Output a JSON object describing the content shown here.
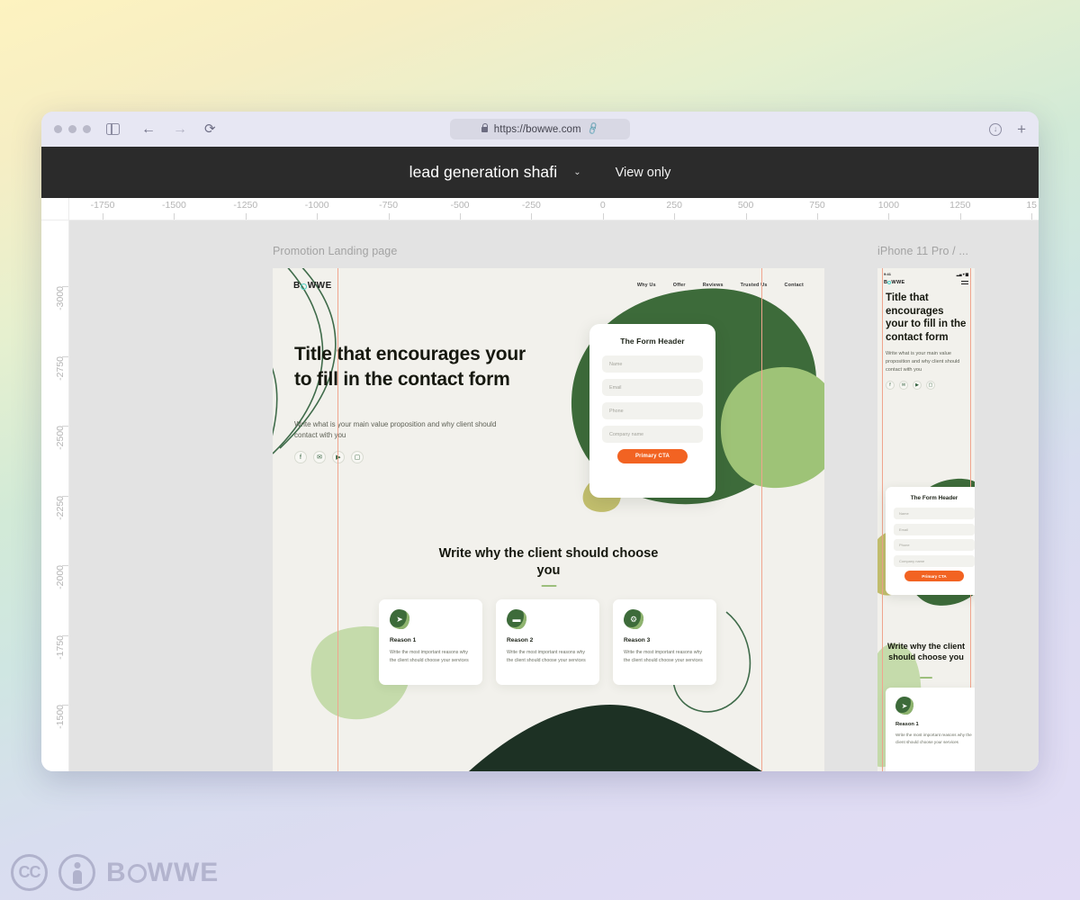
{
  "browser": {
    "url": "https://bowwe.com",
    "icons": {
      "traffic_lights": "window-controls",
      "sidebar": "sidebar-toggle-icon",
      "back": "←",
      "forward": "→",
      "reload": "⟳",
      "lock": "lock-icon",
      "link": "🔗",
      "download": "↓",
      "new_tab": "+"
    }
  },
  "appbar": {
    "project_title": "lead generation shafi",
    "caret": "⌄",
    "view_only": "View only"
  },
  "rulers": {
    "horizontal": [
      "-1750",
      "-1500",
      "-1250",
      "-1000",
      "-750",
      "-500",
      "-250",
      "0",
      "250",
      "500",
      "750",
      "1000",
      "1250",
      "15"
    ],
    "vertical": [
      "-3000",
      "-2750",
      "-2500",
      "-2250",
      "-2000",
      "-1750",
      "-1500"
    ]
  },
  "artboards": {
    "desktop_label": "Promotion Landing page",
    "mobile_label": "iPhone 11 Pro / ..."
  },
  "site": {
    "logo": {
      "before": "B",
      "after": "WWE"
    },
    "menu": [
      "Why Us",
      "Offer",
      "Reviews",
      "Trusted Us",
      "Contact"
    ],
    "hero": {
      "title": "Title that encourages your to fill in the contact form",
      "subtitle": "Write what is your main value proposition and why client should contact with you",
      "socials": [
        "facebook-icon",
        "twitter-icon",
        "youtube-icon",
        "instagram-icon"
      ],
      "social_glyphs": [
        "f",
        "✉",
        "▶",
        "▢"
      ]
    },
    "form": {
      "header": "The Form Header",
      "fields": [
        {
          "placeholder": "Name"
        },
        {
          "placeholder": "Email"
        },
        {
          "placeholder": "Phone"
        },
        {
          "placeholder": "Company name"
        }
      ],
      "cta": "Primary CTA"
    },
    "section2": {
      "title": "Write why the client should choose you",
      "cards": [
        {
          "icon": "paper-plane-icon",
          "glyph": "➤",
          "title": "Reason 1",
          "text": "Write the most important reasons why the client should choose your services"
        },
        {
          "icon": "briefcase-icon",
          "glyph": "▬",
          "title": "Reason 2",
          "text": "Write the most important reasons why the client should choose your services"
        },
        {
          "icon": "gear-icon",
          "glyph": "⚙",
          "title": "Reason 3",
          "text": "Write the most important reasons why the client should choose your services"
        }
      ]
    },
    "mobile": {
      "status_time": "9:41",
      "status_right": "▂▄ ▾ ▆",
      "title": "Title that encourages your to fill in the contact form",
      "subtitle": "Write what is your main value proposition and why client should contact with you",
      "section2_title": "Write why the client should choose you",
      "card": {
        "title": "Reason 1",
        "text": "Write the most important reasons why the client should choose your services"
      }
    }
  },
  "watermark": {
    "cc": "CC",
    "brand_before": "B",
    "brand_after": "WWE"
  },
  "colors": {
    "accent_orange": "#f26322",
    "dark_green": "#3d6b3a",
    "deep_green": "#1d3124",
    "light_green": "#b9d39a",
    "guide_pink": "#f0a58e",
    "page_bg": "#f2f1ec",
    "appbar_bg": "#2b2b2b"
  }
}
